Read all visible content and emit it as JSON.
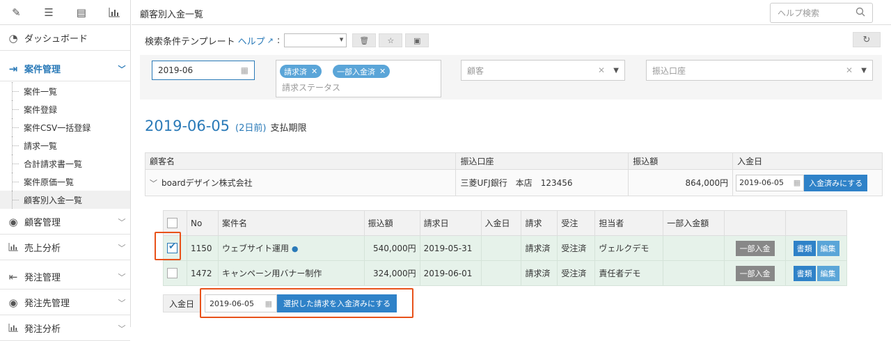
{
  "sidebar": {
    "top_icons": [
      "pencil-icon",
      "list-icon",
      "list-box-icon",
      "bar-chart-icon"
    ],
    "nav": [
      {
        "label": "ダッシュボード",
        "icon": "dashboard-icon"
      },
      {
        "label": "案件管理",
        "icon": "login-arrow-icon",
        "active": true
      },
      {
        "label": "顧客管理",
        "icon": "user-circle-icon"
      },
      {
        "label": "売上分析",
        "icon": "bar-chart-icon"
      },
      {
        "label": "発注管理",
        "icon": "export-arrow-icon"
      },
      {
        "label": "発注先管理",
        "icon": "user-circle-icon"
      },
      {
        "label": "発注分析",
        "icon": "bar-chart-icon"
      }
    ],
    "sub_items": [
      "案件一覧",
      "案件登録",
      "案件CSV一括登録",
      "請求一覧",
      "合計請求書一覧",
      "案件原価一覧",
      "顧客別入金一覧"
    ],
    "selected_sub": "顧客別入金一覧"
  },
  "header": {
    "title": "顧客別入金一覧",
    "help_search_placeholder": "ヘルプ検索"
  },
  "template_row": {
    "label": "検索条件テンプレート",
    "help": "ヘルプ",
    "colon": ":"
  },
  "filters": {
    "month": "2019-06",
    "status_tags": [
      "請求済",
      "一部入金済"
    ],
    "status_placeholder": "請求ステータス",
    "customer_placeholder": "顧客",
    "account_placeholder": "振込口座"
  },
  "due": {
    "date": "2019-06-05",
    "relative": "(2日前)",
    "label": "支払期限"
  },
  "customer_table": {
    "headers": [
      "顧客名",
      "振込口座",
      "振込額",
      "入金日"
    ],
    "row": {
      "customer": "boardデザイン株式会社",
      "account": "三菱UFJ銀行　本店　123456",
      "amount": "864,000円",
      "paid_date": "2019-06-05",
      "action": "入金済みにする"
    }
  },
  "invoice_table": {
    "headers": [
      "No",
      "案件名",
      "振込額",
      "請求日",
      "入金日",
      "請求",
      "受注",
      "担当者",
      "一部入金額"
    ],
    "rows": [
      {
        "checked": true,
        "no": "1150",
        "name": "ウェブサイト運用",
        "amount": "540,000円",
        "invoice_date": "2019-05-31",
        "paid_date": "",
        "billing": "請求済",
        "order": "受注済",
        "owner": "ヴェルクデモ",
        "partial": "",
        "btn_partial": "一部入金",
        "btn_docs": "書類",
        "btn_edit": "編集"
      },
      {
        "checked": false,
        "no": "1472",
        "name": "キャンペーン用バナー制作",
        "amount": "324,000円",
        "invoice_date": "2019-06-01",
        "paid_date": "",
        "billing": "請求済",
        "order": "受注済",
        "owner": "責任者デモ",
        "partial": "",
        "btn_partial": "一部入金",
        "btn_docs": "書類",
        "btn_edit": "編集"
      }
    ]
  },
  "bottom": {
    "label": "入金日",
    "date": "2019-06-05",
    "button": "選択した請求を入金済みにする"
  },
  "colors": {
    "accent": "#2a7ab8",
    "highlight": "#e8521a",
    "row_bg": "#e6f2ea"
  }
}
